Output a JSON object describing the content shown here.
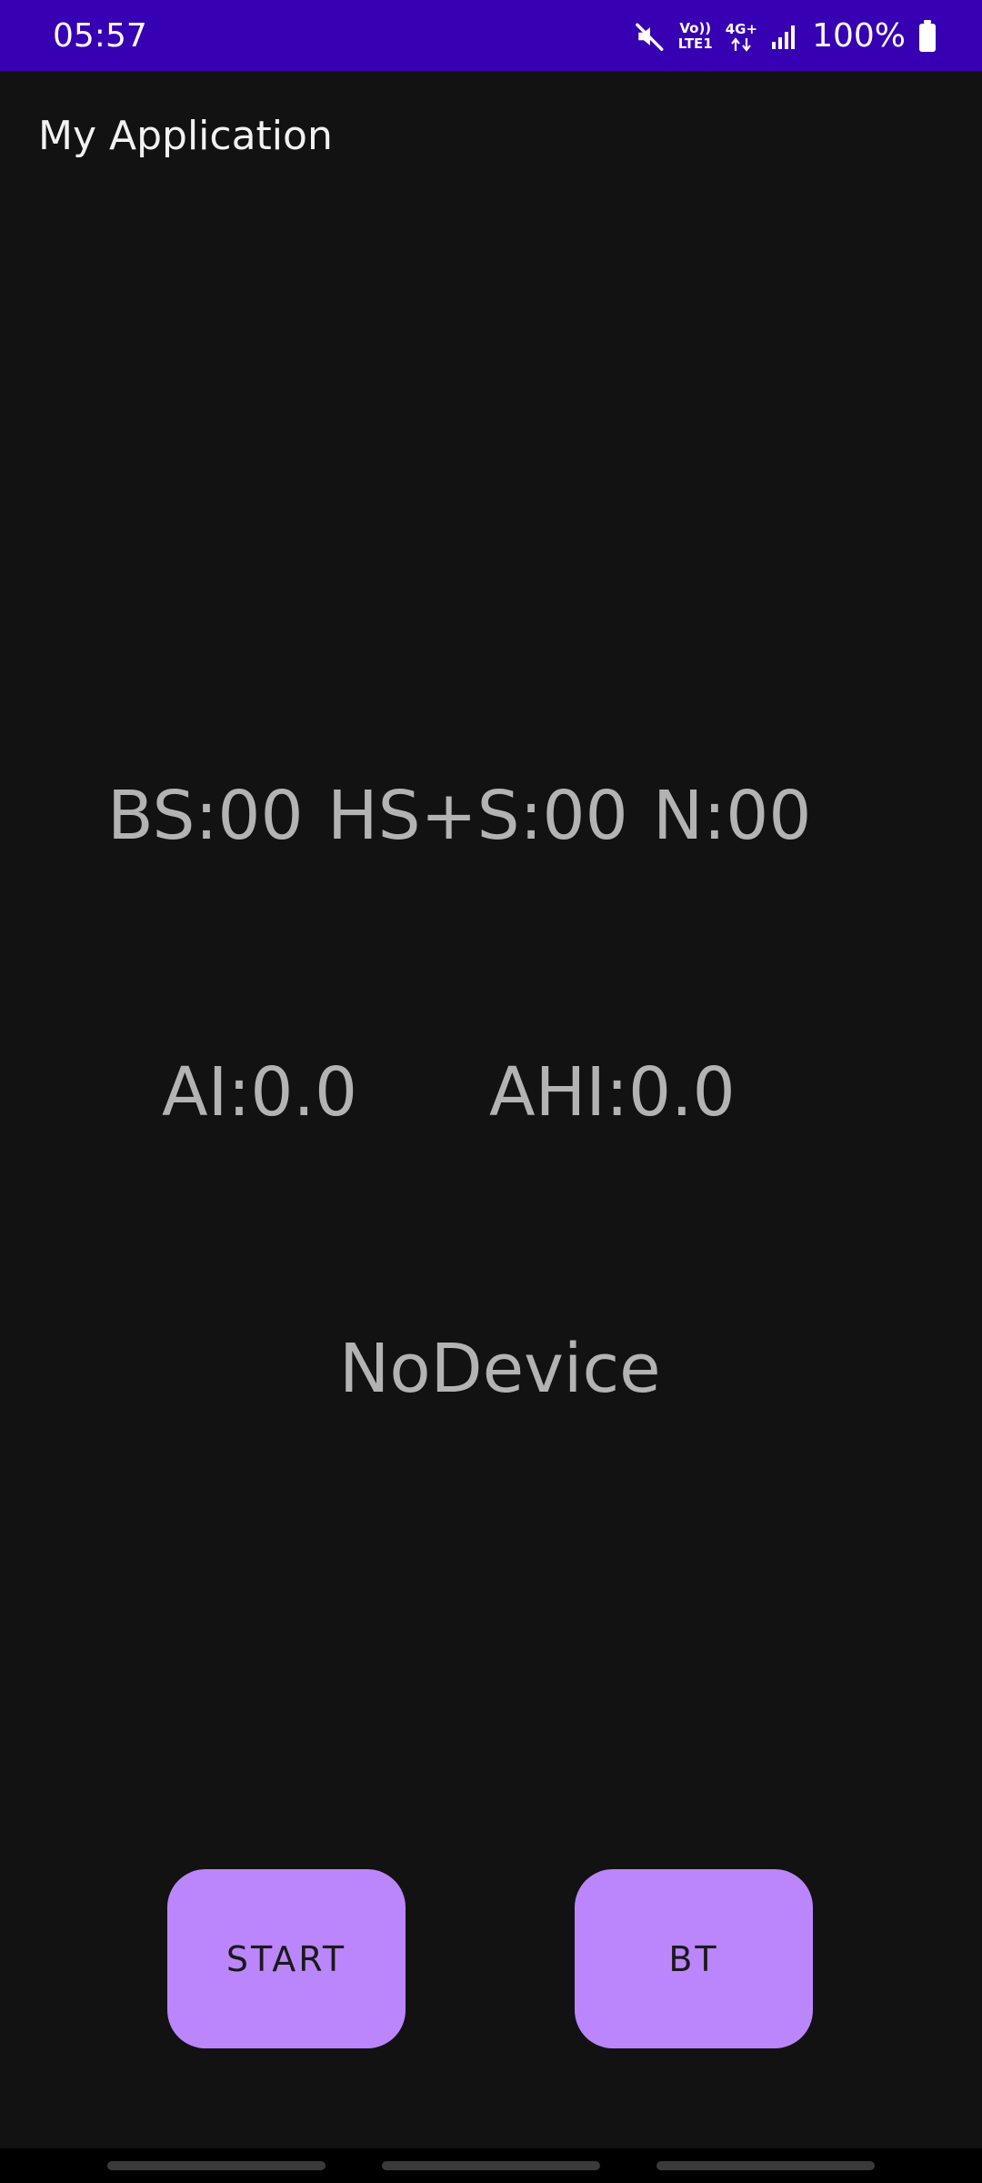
{
  "status_bar": {
    "time": "05:57",
    "volte_top": "Vo))",
    "volte_bottom": "LTE1",
    "network_type": "4G+",
    "battery_percent": "100%",
    "icons": [
      "mute-icon",
      "volte-icon",
      "network-4g-icon",
      "signal-icon",
      "battery-icon"
    ]
  },
  "app": {
    "title": "My Application"
  },
  "metrics": {
    "bs": "BS:00",
    "hs_s": "HS+S:00",
    "n": "N:00",
    "ai": "AI:0.0",
    "ahi": "AHI:0.0"
  },
  "device_status": "NoDevice",
  "buttons": {
    "start": "START",
    "bt": "BT"
  },
  "colors": {
    "status_bar": "#3700B3",
    "background": "#121212",
    "button": "#BB86FC",
    "metric_text": "#B3B3B3"
  }
}
